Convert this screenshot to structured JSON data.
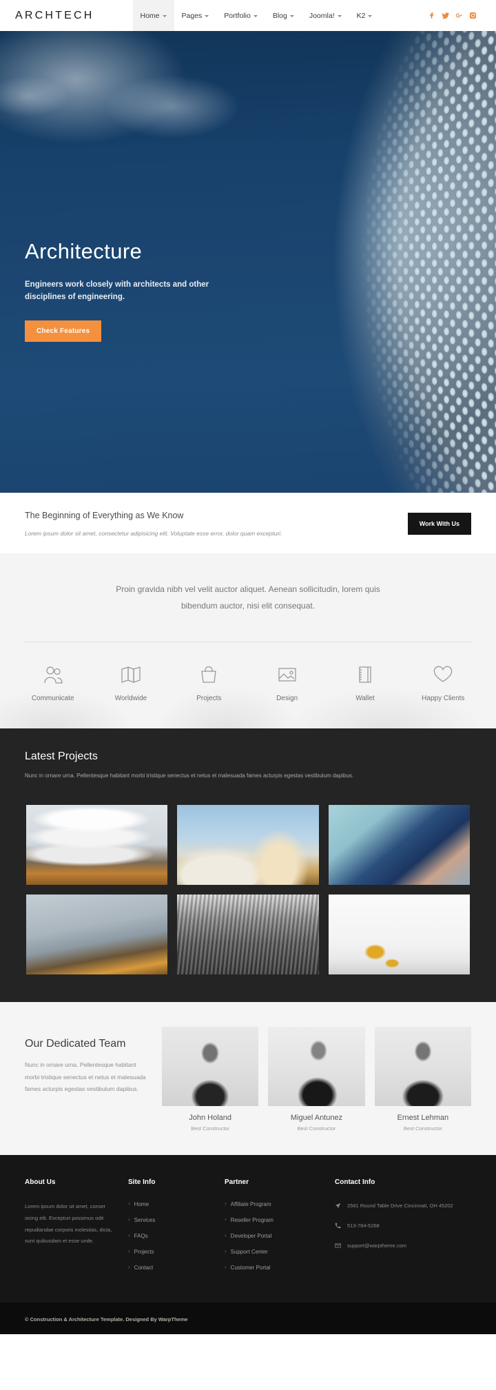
{
  "header": {
    "logo": "ARCHTECH",
    "nav": [
      {
        "label": "Home",
        "caret": true,
        "active": true
      },
      {
        "label": "Pages",
        "caret": true,
        "active": false
      },
      {
        "label": "Portfolio",
        "caret": true,
        "active": false
      },
      {
        "label": "Blog",
        "caret": true,
        "active": false
      },
      {
        "label": "Joomla!",
        "caret": true,
        "active": false
      },
      {
        "label": "K2",
        "caret": true,
        "active": false
      }
    ],
    "socials": [
      {
        "name": "facebook-icon"
      },
      {
        "name": "twitter-icon"
      },
      {
        "name": "google-plus-icon"
      },
      {
        "name": "instagram-icon"
      }
    ],
    "accent": "#f08a3c"
  },
  "hero": {
    "title": "Architecture",
    "subtitle": "Engineers work closely with architects and other disciplines of engineering.",
    "button": "Check Features",
    "button_color": "#f5913e"
  },
  "beginning": {
    "title": "The Beginning of Everything as We Know",
    "text": "Lorem ipsum dolor sit amet, consectetur adipisicing elit. Voluptate esse error, dolor quam excepturi.",
    "button": "Work With Us"
  },
  "intro": {
    "text": "Proin gravida nibh vel velit auctor aliquet. Aenean sollicitudin, lorem quis bibendum auctor, nisi elit consequat."
  },
  "features": [
    {
      "label": "Communicate",
      "icon": "users-icon"
    },
    {
      "label": "Worldwide",
      "icon": "map-icon"
    },
    {
      "label": "Projects",
      "icon": "bag-icon"
    },
    {
      "label": "Design",
      "icon": "image-icon"
    },
    {
      "label": "Wallet",
      "icon": "notebook-icon"
    },
    {
      "label": "Happy Clients",
      "icon": "heart-icon"
    }
  ],
  "projects": {
    "title": "Latest Projects",
    "subtitle": "Nunc in ornare urna. Pellentesque habitant morbi tristique senectus et netus et malesuada fames acturpis egestas vestibulum dapibus.",
    "items": [
      {
        "name": "curved-white-building"
      },
      {
        "name": "wave-roof-concert-hall"
      },
      {
        "name": "blue-glass-facade"
      },
      {
        "name": "metal-clad-pavilion"
      },
      {
        "name": "skyscrapers-black-white"
      },
      {
        "name": "white-modern-interior"
      }
    ]
  },
  "team": {
    "title": "Our Dedicated Team",
    "description": "Nunc in ornare urna. Pellentesque habitant morbi tristique senectus et netus et malesuada fames acturpis egestas vestibulum dapibus.",
    "members": [
      {
        "name": "John Holand",
        "role": "Best Constructor"
      },
      {
        "name": "Miguel Antunez",
        "role": "Best Constructor"
      },
      {
        "name": "Ernest Lehman",
        "role": "Best Constructor"
      }
    ]
  },
  "footer": {
    "about": {
      "title": "About Us",
      "text": "Lorem ipsum dolor sit amet, conser sicing elit. Excepturi possimus odit repudiandae corporis molestias, dicta, sunt quibusdam et esse unde."
    },
    "site_info": {
      "title": "Site Info",
      "links": [
        "Home",
        "Services",
        "FAQs",
        "Projects",
        "Contact"
      ]
    },
    "partner": {
      "title": "Partner",
      "links": [
        "Affiliate Program",
        "Reseller Program",
        "Developer Portal",
        "Support Center",
        "Customer Portal"
      ]
    },
    "contact": {
      "title": "Contact Info",
      "address": "2561 Round Table Drive Cincinnati, OH 45202",
      "phone": "513-784-5268",
      "email": "support@warptheme.com"
    },
    "copyright": "© Construction & Architecture Template. Designed By WarpTheme"
  }
}
